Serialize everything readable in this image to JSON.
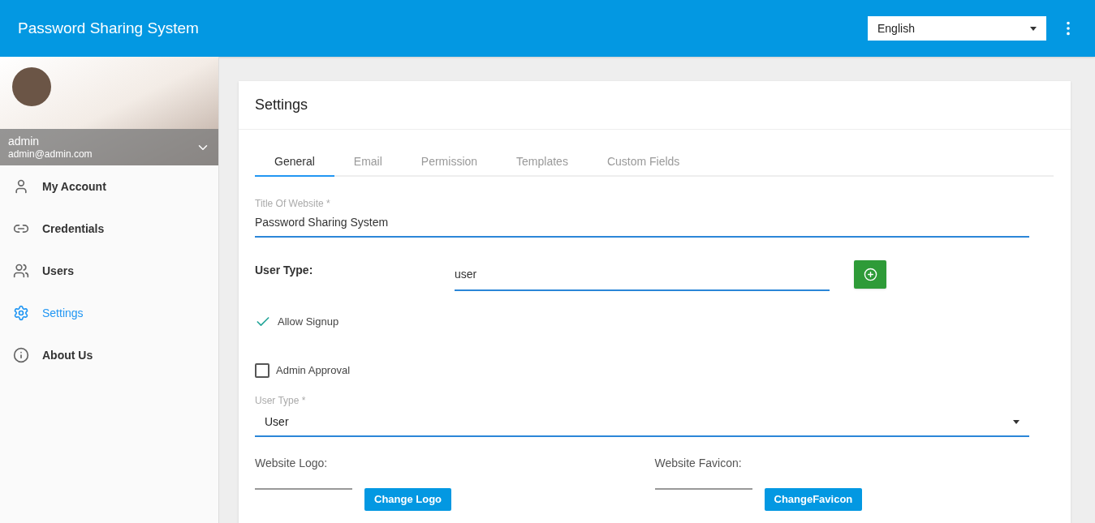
{
  "app_bar": {
    "title": "Password Sharing System",
    "language": "English"
  },
  "profile": {
    "name": "admin",
    "email": "admin@admin.com"
  },
  "sidebar": {
    "items": [
      {
        "label": "My Account",
        "selected": false
      },
      {
        "label": "Credentials",
        "selected": false
      },
      {
        "label": "Users",
        "selected": false
      },
      {
        "label": "Settings",
        "selected": true
      },
      {
        "label": "About Us",
        "selected": false
      }
    ]
  },
  "settings": {
    "title": "Settings",
    "tabs": [
      {
        "label": "General",
        "selected": true
      },
      {
        "label": "Email",
        "selected": false
      },
      {
        "label": "Permission",
        "selected": false
      },
      {
        "label": "Templates",
        "selected": false
      },
      {
        "label": "Custom Fields",
        "selected": false
      }
    ],
    "website_title": {
      "label": "Title Of Website *",
      "value": "Password Sharing System"
    },
    "user_type_add": {
      "label": "User Type:",
      "value": "user"
    },
    "checkboxes": [
      {
        "label": "Allow Signup",
        "checked": true
      },
      {
        "label": "Admin Approval",
        "checked": false
      }
    ],
    "user_type_select": {
      "label": "User Type *",
      "value": "User"
    },
    "logo": {
      "label": "Website Logo:",
      "button": "Change Logo"
    },
    "favicon": {
      "label": "Website Favicon:",
      "button": "ChangeFavicon"
    }
  }
}
